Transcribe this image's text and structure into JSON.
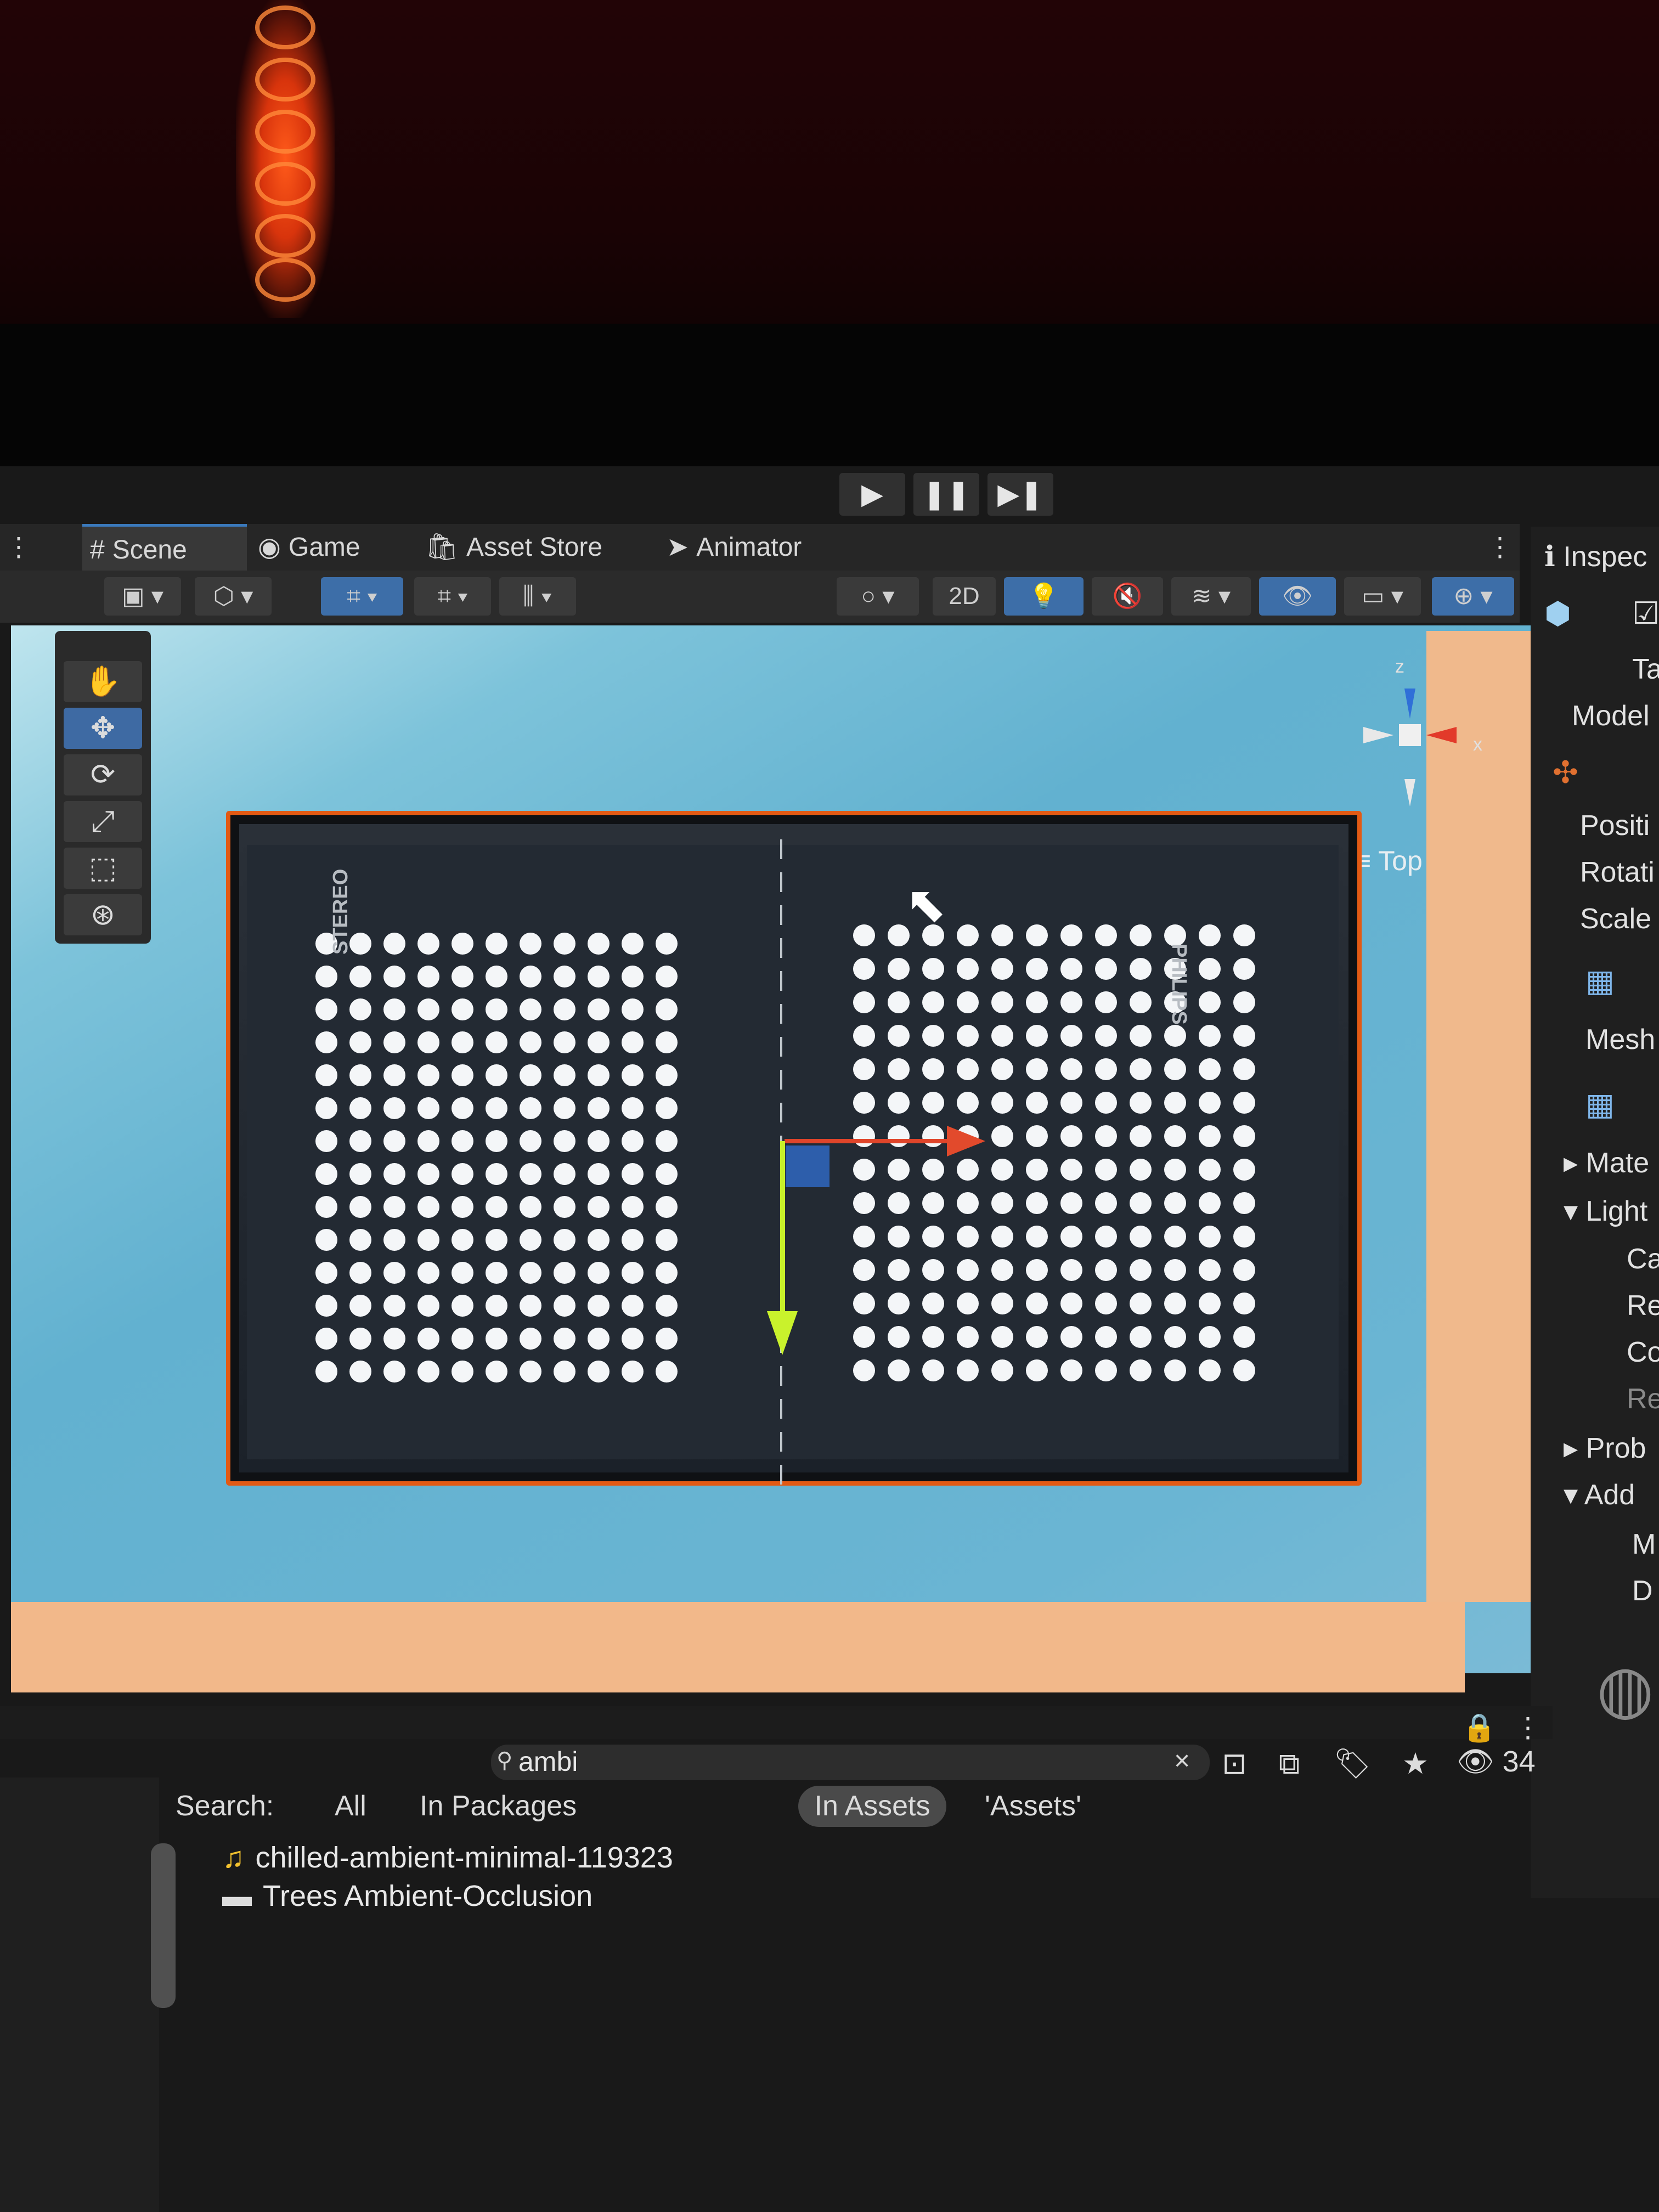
{
  "playback": {
    "play": "▶",
    "pause": "❚❚",
    "step": "▶❚"
  },
  "tabs": [
    {
      "icon": "#",
      "label": "Scene"
    },
    {
      "icon": "◉",
      "label": "Game"
    },
    {
      "icon": "🛍",
      "label": "Asset Store"
    },
    {
      "icon": "➤",
      "label": "Animator"
    }
  ],
  "toolbar": {
    "mode_2d": "2D"
  },
  "scene": {
    "view_label": "Top",
    "brand_left": "STEREO",
    "brand_right": "PHILIPS",
    "gizmo_x": "x",
    "gizmo_z": "z"
  },
  "inspector": {
    "title": "Inspec",
    "tag_partial": "Ta",
    "model_partial": "Model",
    "position_partial": "Positi",
    "rotation_partial": "Rotati",
    "scale_partial": "Scale",
    "mesh_partial": "Mesh",
    "materials_partial": "Mate",
    "lighting_partial": "Light",
    "ca_partial": "Ca",
    "re_partial": "Re",
    "co_partial": "Co",
    "re2_partial": "Re",
    "probes_partial": "Prob",
    "additional_partial": "Add",
    "m_partial": "M",
    "d_partial": "D"
  },
  "project": {
    "search_value": "ambi",
    "hidden_count": "34",
    "filters": {
      "label": "Search:",
      "all": "All",
      "in_packages": "In Packages",
      "in_assets": "In Assets",
      "assets_folder": "'Assets'"
    },
    "results": [
      {
        "icon": "♫",
        "name": "chilled-ambient-minimal-119323"
      },
      {
        "icon": "▬",
        "name": "Trees Ambient-Occlusion"
      }
    ]
  },
  "colors": {
    "accent": "#3d6ea8",
    "selection_outline": "#e35a14",
    "x_axis": "#e24a2c",
    "y_axis": "#c9f22c",
    "z_axis": "#2f64b8"
  }
}
